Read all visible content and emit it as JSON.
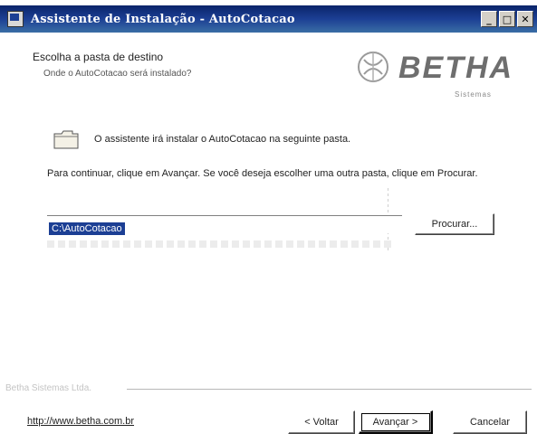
{
  "window": {
    "title": "Assistente de Instalação - AutoCotacao",
    "minimize_label": "_",
    "maximize_label": "□",
    "close_label": "✕"
  },
  "header": {
    "title": "Escolha a pasta de destino",
    "subtitle": "Onde o AutoCotacao será instalado?",
    "logo_text": "BETHA",
    "logo_sub": "Sistemas"
  },
  "main": {
    "folder_message": "O assistente irá instalar o AutoCotacao na seguinte pasta.",
    "instruction": "Para continuar, clique em Avançar. Se você deseja escolher uma outra pasta, clique em Procurar.",
    "install_path": "C:\\AutoCotacao",
    "browse_label": "Procurar..."
  },
  "separator": {
    "label": "Betha Sistemas Ltda."
  },
  "footer": {
    "link": "http://www.betha.com.br",
    "back_label": "< Voltar",
    "next_label": "Avançar >",
    "cancel_label": "Cancelar"
  },
  "colors": {
    "titlebar": "#0a246a",
    "selection": "#1c3f94",
    "logo": "#6e6e6e"
  }
}
